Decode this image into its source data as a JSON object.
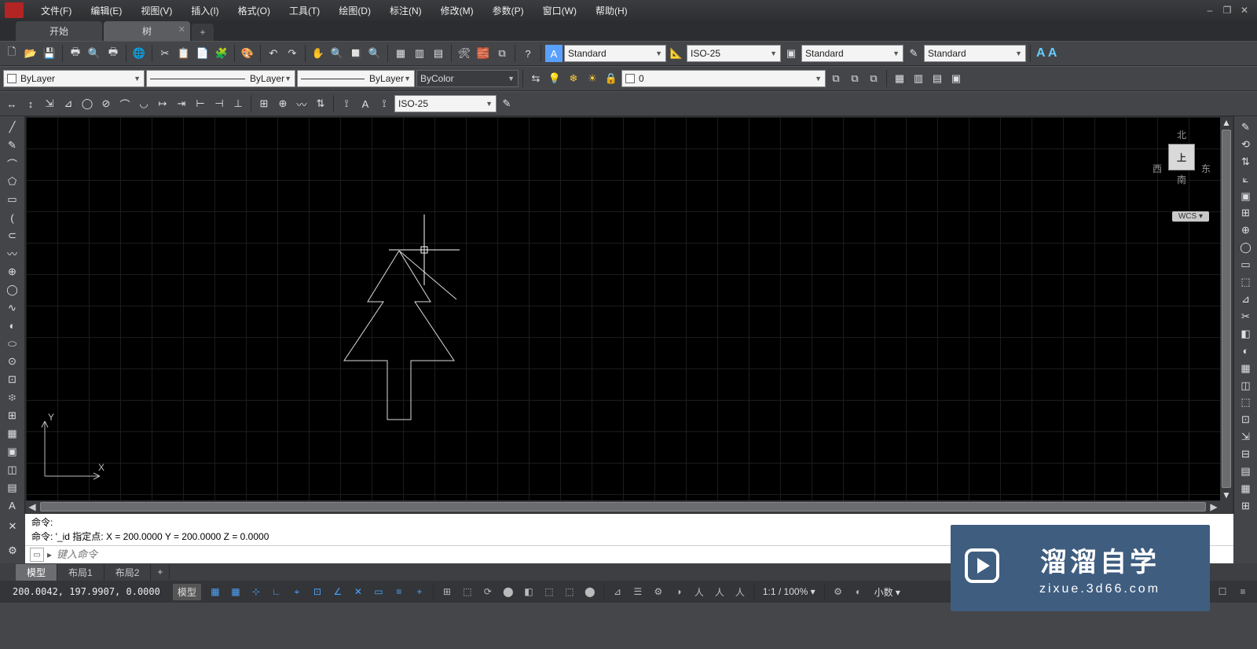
{
  "menu": {
    "items": [
      "文件(F)",
      "编辑(E)",
      "视图(V)",
      "插入(I)",
      "格式(O)",
      "工具(T)",
      "绘图(D)",
      "标注(N)",
      "修改(M)",
      "参数(P)",
      "窗口(W)",
      "帮助(H)"
    ]
  },
  "win": {
    "min": "–",
    "restore": "❐",
    "close": "✕"
  },
  "tabs": {
    "items": [
      {
        "label": "开始",
        "active": false
      },
      {
        "label": "树",
        "active": true
      }
    ],
    "plus": "+"
  },
  "tb1": {
    "std": [
      "🗋",
      "📂",
      "💾",
      "|",
      "🖶",
      "🔍",
      "🖶",
      "|",
      "🌐",
      "|",
      "✂",
      "📋",
      "📄",
      "🧩",
      "|",
      "🎨",
      "|",
      "↶",
      "↷",
      "|",
      "✋",
      "🔍",
      "🔲",
      "🔍",
      "|",
      "▦",
      "▥",
      "▤",
      "|",
      "🛠",
      "🧱",
      "⧉",
      "|",
      "?"
    ],
    "style1_ico": "A",
    "style1": "Standard",
    "dim_ico": "📐",
    "dim": "ISO-25",
    "style2_ico": "▣",
    "style2": "Standard",
    "style3_ico": "✎",
    "style3": "Standard",
    "aa": "A A"
  },
  "tb2": {
    "layer": "ByLayer",
    "ltype": "ByLayer",
    "lweight": "ByLayer",
    "color": "ByColor",
    "layer_tools": [
      "⇆",
      "💡",
      "❄",
      "☀",
      "🔒",
      "▭"
    ],
    "layer_current": "0",
    "lay_icons": [
      "⧉",
      "⧉",
      "⧉"
    ],
    "view_icons": [
      "▦",
      "▥",
      "▤",
      "▣"
    ]
  },
  "tb3": {
    "dims": [
      "↔",
      "↕",
      "⇲",
      "⊿",
      "◯",
      "⊘",
      "⌒",
      "◡",
      "↦",
      "⇥",
      "⊢",
      "⊣",
      "⊥",
      "|",
      "⊞",
      "⊕",
      "〰",
      "⇅",
      "|",
      "⟟",
      "A",
      "⟟"
    ],
    "dimstyle": "ISO-25",
    "after": [
      "✎"
    ]
  },
  "left_tools": [
    "╱",
    "✎",
    "⌒",
    "⬠",
    "▭",
    "(",
    "⊂",
    "〰",
    "⊕",
    "◯",
    "∿",
    "◐",
    "⬭",
    "⊙",
    "⊡",
    "፨",
    "⊞",
    "▦",
    "▣",
    "◫",
    "▤",
    "A"
  ],
  "right_top": [
    "✎",
    "⟲",
    "⇅",
    "⟀",
    "▣",
    "⊞",
    "⊕",
    "◯",
    "▭",
    "⬚",
    "⊿",
    "✂",
    "◧",
    "◐",
    "▦",
    "◫",
    "⬚",
    "⊡",
    "⇲",
    "⊟",
    "▤",
    "▦",
    "⊞"
  ],
  "viewcube": {
    "n": "北",
    "s": "南",
    "e": "东",
    "w": "西",
    "top": "上",
    "wcs": "WCS ▾"
  },
  "ucs": {
    "x": "X",
    "y": "Y"
  },
  "cmd": {
    "line1": "命令:",
    "line2": "命令: '_id 指定点:   X = 200.0000    Y = 200.0000    Z = 0.0000",
    "placeholder": "键入命令",
    "caret": "▸"
  },
  "layouts": {
    "items": [
      {
        "label": "模型",
        "active": true
      },
      {
        "label": "布局1"
      },
      {
        "label": "布局2"
      }
    ],
    "plus": "+"
  },
  "status": {
    "coords": "200.0042, 197.9907, 0.0000",
    "model": "模型",
    "scale": "1:1 / 100% ▾",
    "annoscale": "小数 ▾",
    "icons1": [
      "▦",
      "▦",
      "⊹",
      "∟",
      "⌖",
      "⊡",
      "∠",
      "✕",
      "▭",
      "≡",
      "+"
    ],
    "icons2": [
      "⊞",
      "⬚",
      "⟳",
      "⬤",
      "◧",
      "⬚",
      "⬚",
      "⬤"
    ],
    "icons3": [
      "⊿",
      "☰",
      "⚙",
      "◑",
      "人",
      "人",
      "人"
    ],
    "right": [
      "⊕",
      "☰",
      "⛶",
      "⚙",
      "▭",
      "☐",
      "≡"
    ]
  },
  "watermark": {
    "big": "溜溜自学",
    "url": "zixue.3d66.com"
  }
}
